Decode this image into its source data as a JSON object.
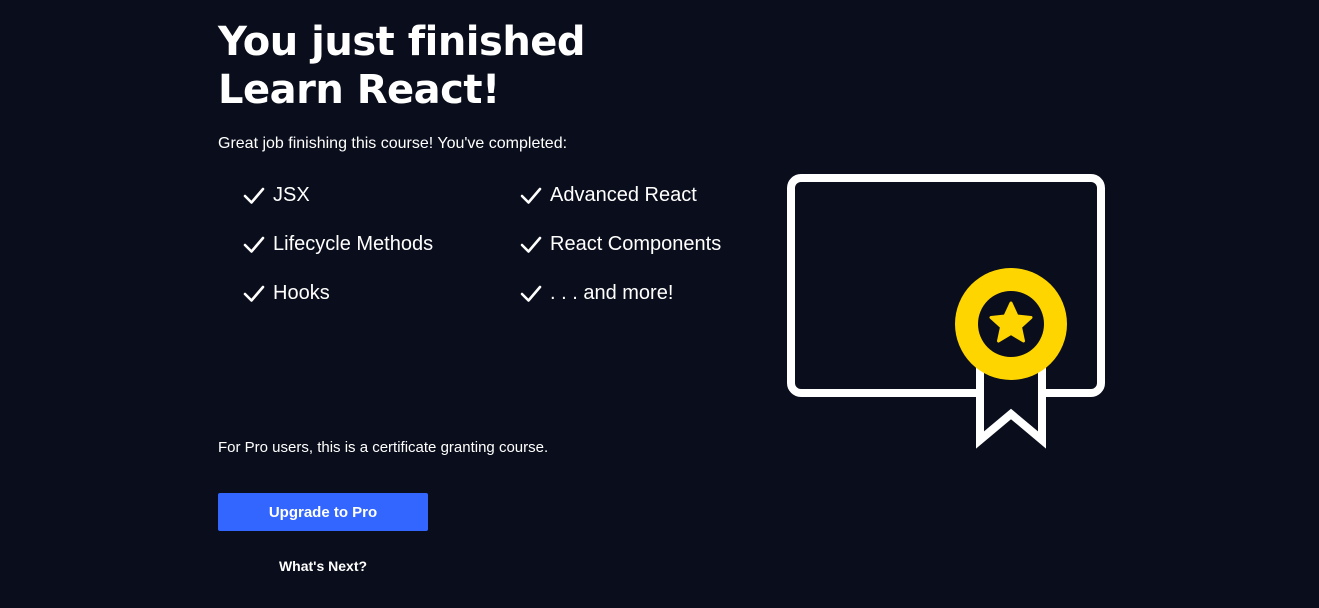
{
  "heading": {
    "line1": "You just finished",
    "line2": "Learn React!"
  },
  "subtitle": "Great job finishing this course! You've completed:",
  "topics": [
    {
      "label": "JSX",
      "icon": "check-icon"
    },
    {
      "label": "Advanced React",
      "icon": "check-icon"
    },
    {
      "label": "Lifecycle Methods",
      "icon": "check-icon"
    },
    {
      "label": "React Components",
      "icon": "check-icon"
    },
    {
      "label": "Hooks",
      "icon": "check-icon"
    },
    {
      "label": ". . . and more!",
      "icon": "check-icon"
    }
  ],
  "pro_note": "For Pro users, this is a certificate granting course.",
  "upgrade_button": {
    "label": "Upgrade to Pro"
  },
  "whats_next": {
    "label": "What's Next?"
  },
  "certificate": {
    "icon": "certificate-icon",
    "badge_icon": "star-badge-icon"
  },
  "colors": {
    "background": "#0a0d1b",
    "text": "#ffffff",
    "button": "#3366ff",
    "badge": "#ffd500"
  }
}
